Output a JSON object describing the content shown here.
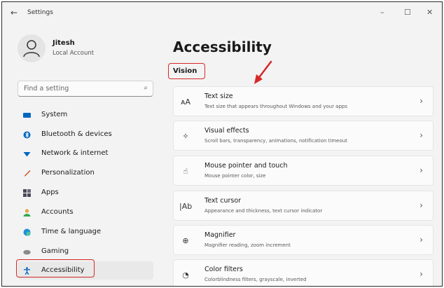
{
  "titlebar": {
    "back_glyph": "←",
    "title": "Settings",
    "minimize_glyph": "–",
    "maximize_glyph": "☐",
    "close_glyph": "✕"
  },
  "profile": {
    "name": "Jitesh",
    "account": "Local Account"
  },
  "search": {
    "placeholder": "Find a setting",
    "icon": "search-icon"
  },
  "sidebar": {
    "items": [
      {
        "label": "System",
        "icon": "system-icon",
        "color": "#0067c0"
      },
      {
        "label": "Bluetooth & devices",
        "icon": "bluetooth-icon",
        "color": "#0067c0"
      },
      {
        "label": "Network & internet",
        "icon": "network-icon",
        "color": "#0067c0"
      },
      {
        "label": "Personalization",
        "icon": "brush-icon",
        "color": "#c94f1e"
      },
      {
        "label": "Apps",
        "icon": "apps-icon",
        "color": "#4a4a5a"
      },
      {
        "label": "Accounts",
        "icon": "accounts-icon",
        "color": "#2fa84f"
      },
      {
        "label": "Time & language",
        "icon": "globe-clock-icon",
        "color": "#1f8fd6"
      },
      {
        "label": "Gaming",
        "icon": "gamepad-icon",
        "color": "#7a7a7a"
      },
      {
        "label": "Accessibility",
        "icon": "accessibility-icon",
        "color": "#0067c0",
        "selected": true
      }
    ]
  },
  "main": {
    "title": "Accessibility",
    "section": "Vision",
    "cards": [
      {
        "title": "Text size",
        "subtitle": "Text size that appears throughout Windows and your apps",
        "icon": "text-size-icon",
        "glyph": "ᴀA"
      },
      {
        "title": "Visual effects",
        "subtitle": "Scroll bars, transparency, animations, notification timeout",
        "icon": "sparkle-icon",
        "glyph": "✧"
      },
      {
        "title": "Mouse pointer and touch",
        "subtitle": "Mouse pointer color, size",
        "icon": "pointer-touch-icon",
        "glyph": "☝"
      },
      {
        "title": "Text cursor",
        "subtitle": "Appearance and thickness, text cursor indicator",
        "icon": "text-cursor-icon",
        "glyph": "|Ab"
      },
      {
        "title": "Magnifier",
        "subtitle": "Magnifier reading, zoom increment",
        "icon": "magnifier-icon",
        "glyph": "⊕"
      },
      {
        "title": "Color filters",
        "subtitle": "Colorblindness filters, grayscale, inverted",
        "icon": "color-filter-icon",
        "glyph": "◔"
      }
    ],
    "chevron_glyph": "›"
  },
  "colors": {
    "annotation_red": "#d62828",
    "accent": "#0067c0"
  }
}
